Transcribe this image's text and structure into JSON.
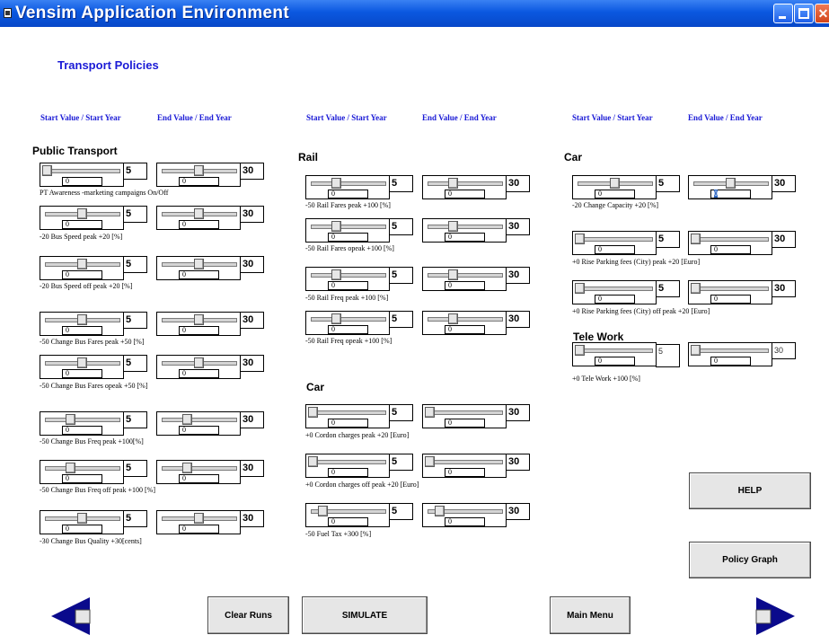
{
  "window": {
    "title": "Vensim Application Environment"
  },
  "page": {
    "title": "Transport Policies",
    "column_headers": {
      "start": "Start Value / Start Year",
      "end": "End Value / End Year"
    }
  },
  "sections": {
    "public_transport": "Public Transport",
    "rail": "Rail",
    "car_left": "Car",
    "car_right": "Car",
    "tele_work": "Tele Work"
  },
  "policies": {
    "pt_awareness": {
      "label": "PT Awareness -marketing campaigns On/Off",
      "start_value": "5",
      "end_value": "30",
      "field": "0"
    },
    "bus_speed_peak": {
      "label": "-20   Bus Speed peak  +20 [%]",
      "start_value": "5",
      "end_value": "30",
      "field": "0"
    },
    "bus_speed_off": {
      "label": "-20   Bus Speed off peak  +20 [%]",
      "start_value": "5",
      "end_value": "30",
      "field": "0"
    },
    "bus_fares_peak": {
      "label": "-50   Change Bus Fares  peak +50 [%]",
      "start_value": "5",
      "end_value": "30",
      "field": "0"
    },
    "bus_fares_opeak": {
      "label": "-50   Change Bus Fares opeak  +50 [%]",
      "start_value": "5",
      "end_value": "30",
      "field": "0"
    },
    "bus_freq_peak": {
      "label": "-50   Change Bus Freq peak   +100[%]",
      "start_value": "5",
      "end_value": "30",
      "field": "0"
    },
    "bus_freq_off": {
      "label": "-50   Change Bus Freq off peak  +100 [%]",
      "start_value": "5",
      "end_value": "30",
      "field": "0"
    },
    "bus_quality": {
      "label": "-30   Change Bus Quality  +30[cents]",
      "start_value": "5",
      "end_value": "30",
      "field": "0"
    },
    "rail_fares_peak": {
      "label": "-50   Rail Fares peak +100 [%]",
      "start_value": "5",
      "end_value": "30",
      "field": "0"
    },
    "rail_fares_opeak": {
      "label": "-50   Rail Fares opeak  +100 [%]",
      "start_value": "5",
      "end_value": "30",
      "field": "0"
    },
    "rail_freq_peak": {
      "label": "-50  Rail Freq peak +100 [%]",
      "start_value": "5",
      "end_value": "30",
      "field": "0"
    },
    "rail_freq_opeak": {
      "label": "-50   Rail Freq opeak  +100 [%]",
      "start_value": "5",
      "end_value": "30",
      "field": "0"
    },
    "cordon_peak": {
      "label": "+0    Cordon charges peak  +20 [Euro]",
      "start_value": "5",
      "end_value": "30",
      "field": "0"
    },
    "cordon_off": {
      "label": "+0    Cordon charges off peak  +20 [Euro]",
      "start_value": "5",
      "end_value": "30",
      "field": "0"
    },
    "fuel_tax": {
      "label": "-50   Fuel Tax  +300 [%]",
      "start_value": "5",
      "end_value": "30",
      "field": "0"
    },
    "change_capacity": {
      "label": "-20   Change Capacity   +20 [%]",
      "start_value": "5",
      "end_value": "30",
      "field": "0"
    },
    "parking_peak": {
      "label": "+0    Rise Parking  fees (City) peak  +20 [Euro]",
      "start_value": "5",
      "end_value": "30",
      "field": "0"
    },
    "parking_off": {
      "label": "+0    Rise Parking  fees (City) off peak  +20 [Euro]",
      "start_value": "5",
      "end_value": "30",
      "field": "0"
    },
    "tele_work": {
      "label": "+0 Tele Work +100 [%]",
      "start_value": "5",
      "end_value": "30",
      "field": "0"
    }
  },
  "buttons": {
    "help": "HELP",
    "policy_graph": "Policy Graph",
    "clear_runs": "Clear Runs",
    "simulate": "SIMULATE",
    "main_menu": "Main Menu"
  },
  "colors": {
    "arrow": "#0a0a8c",
    "header_text": "#1a1ad6",
    "titlebar": "#0a58e0"
  },
  "icons": {
    "back": "left-arrow-icon",
    "next": "right-arrow-icon"
  }
}
